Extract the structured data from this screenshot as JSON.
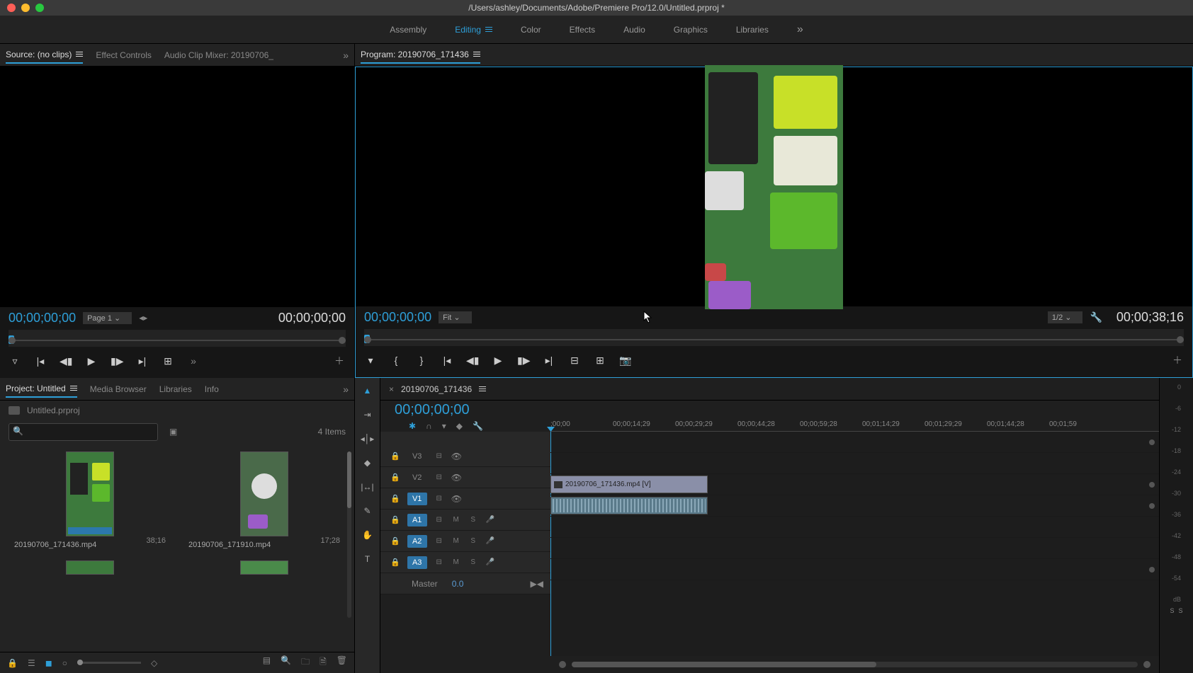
{
  "titlebar": {
    "path": "/Users/ashley/Documents/Adobe/Premiere Pro/12.0/Untitled.prproj *"
  },
  "workspaces": {
    "items": [
      "Assembly",
      "Editing",
      "Color",
      "Effects",
      "Audio",
      "Graphics",
      "Libraries"
    ],
    "active": "Editing"
  },
  "source_panel": {
    "tabs": {
      "source": "Source: (no clips)",
      "effect": "Effect Controls",
      "mixer": "Audio Clip Mixer: 20190706_"
    },
    "tc_in": "00;00;00;00",
    "tc_out": "00;00;00;00",
    "zoom": "Page 1"
  },
  "program_panel": {
    "tab": "Program: 20190706_171436",
    "tc_in": "00;00;00;00",
    "tc_out": "00;00;38;16",
    "fit": "Fit",
    "res": "1/2"
  },
  "project_panel": {
    "tabs": {
      "project": "Project: Untitled",
      "media": "Media Browser",
      "lib": "Libraries",
      "info": "Info"
    },
    "bin": "Untitled.prproj",
    "items_count": "4 Items",
    "clips": [
      {
        "name": "20190706_171436.mp4",
        "dur": "38;16"
      },
      {
        "name": "20190706_171910.mp4",
        "dur": "17;28"
      }
    ]
  },
  "timeline": {
    "sequence": "20190706_171436",
    "tc": "00;00;00;00",
    "ruler": [
      ";00;00",
      "00;00;14;29",
      "00;00;29;29",
      "00;00;44;28",
      "00;00;59;28",
      "00;01;14;29",
      "00;01;29;29",
      "00;01;44;28",
      "00;01;59"
    ],
    "tracks": {
      "v": [
        "V3",
        "V2",
        "V1"
      ],
      "a": [
        "A1",
        "A2",
        "A3"
      ],
      "master": "Master",
      "master_db": "0.0"
    },
    "clip_name": "20190706_171436.mp4 [V]"
  },
  "meters": {
    "scale": [
      "0",
      "-6",
      "-12",
      "-18",
      "-24",
      "-30",
      "-36",
      "-42",
      "-48",
      "-54",
      "dB"
    ],
    "labels": [
      "S",
      "S"
    ]
  }
}
